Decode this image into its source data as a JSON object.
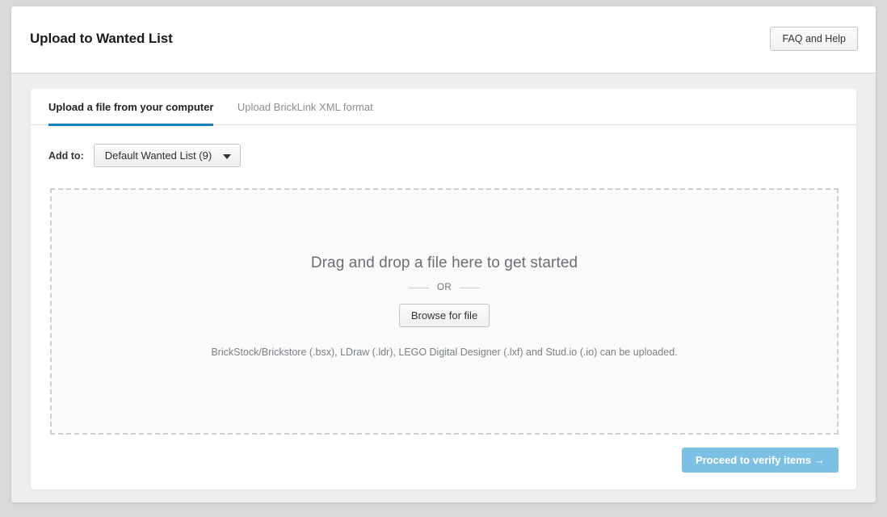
{
  "header": {
    "title": "Upload to Wanted List",
    "faq_button": "FAQ and Help"
  },
  "tabs": [
    {
      "label": "Upload a file from your computer",
      "active": true
    },
    {
      "label": "Upload BrickLink XML format",
      "active": false
    }
  ],
  "add_to": {
    "label": "Add to:",
    "selected": "Default Wanted List (9)",
    "caret_icon": "chevron-down-icon"
  },
  "dropzone": {
    "headline": "Drag and drop a file here to get started",
    "or_text": "OR",
    "browse_button": "Browse for file",
    "formats": "BrickStock/Brickstore (.bsx), LDraw (.ldr), LEGO Digital Designer (.lxf) and Stud.io (.io) can be uploaded."
  },
  "footer": {
    "proceed_label": "Proceed to verify items",
    "proceed_arrow": "→"
  },
  "colors": {
    "accent_tab_underline": "#1a7fc1",
    "proceed_button": "#7cc0e3",
    "page_background": "#d9d9d9",
    "frame_background": "#eeeeee",
    "dropzone_border": "#cfcfcf"
  }
}
